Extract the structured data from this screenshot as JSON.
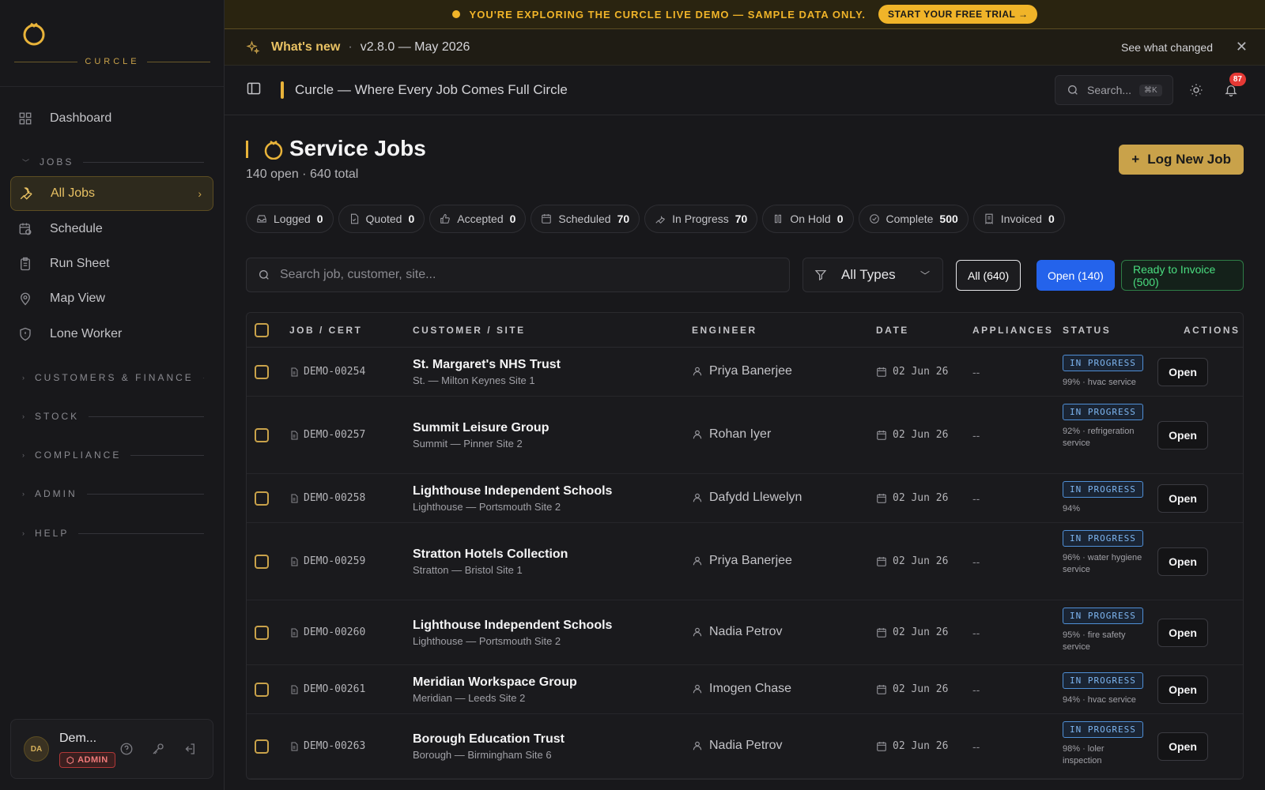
{
  "brand": {
    "name": "CURCLE"
  },
  "sidebar": {
    "dashboard": "Dashboard",
    "sections": {
      "jobs": "JOBS",
      "customers_finance": "CUSTOMERS & FINANCE",
      "stock": "STOCK",
      "compliance": "COMPLIANCE",
      "admin": "ADMIN",
      "help": "HELP"
    },
    "items": [
      {
        "label": "All Jobs",
        "icon": "wrench-icon",
        "active": true
      },
      {
        "label": "Schedule",
        "icon": "calendar-clock-icon"
      },
      {
        "label": "Run Sheet",
        "icon": "clipboard-icon"
      },
      {
        "label": "Map View",
        "icon": "map-pin-icon"
      },
      {
        "label": "Lone Worker",
        "icon": "shield-icon"
      }
    ],
    "user": {
      "initials": "DA",
      "name": "Dem...",
      "role": "ADMIN"
    }
  },
  "banner": {
    "text": "YOU'RE EXPLORING THE CURCLE LIVE DEMO — SAMPLE DATA ONLY.",
    "cta": "START YOUR FREE TRIAL →"
  },
  "whats_new": {
    "title": "What's new",
    "separator": "·",
    "version": "v2.8.0 — May 2026",
    "link": "See what changed",
    "close": "✕"
  },
  "topbar": {
    "title": "Curcle — Where Every Job Comes Full Circle",
    "search_placeholder": "Search...",
    "shortcut": "⌘K",
    "notifications": "87"
  },
  "page": {
    "title": "Service Jobs",
    "subtitle": "140 open · 640 total",
    "new_button": "Log New Job"
  },
  "status_chips": [
    {
      "label": "Logged",
      "count": "0",
      "icon": "inbox-icon"
    },
    {
      "label": "Quoted",
      "count": "0",
      "icon": "file-check-icon"
    },
    {
      "label": "Accepted",
      "count": "0",
      "icon": "thumbs-up-icon"
    },
    {
      "label": "Scheduled",
      "count": "70",
      "icon": "calendar-icon"
    },
    {
      "label": "In Progress",
      "count": "70",
      "icon": "wrench-icon"
    },
    {
      "label": "On Hold",
      "count": "0",
      "icon": "pause-icon"
    },
    {
      "label": "Complete",
      "count": "500",
      "icon": "check-circle-icon"
    },
    {
      "label": "Invoiced",
      "count": "0",
      "icon": "receipt-icon"
    }
  ],
  "filters": {
    "search_placeholder": "Search job, customer, site...",
    "type": "All Types",
    "all": "All (640)",
    "open": "Open (140)",
    "ready": "Ready to Invoice (500)"
  },
  "table": {
    "headers": {
      "job": "JOB / CERT",
      "customer": "CUSTOMER / SITE",
      "engineer": "ENGINEER",
      "date": "DATE",
      "appliances": "APPLIANCES",
      "status": "STATUS",
      "actions": "ACTIONS"
    },
    "rows": [
      {
        "job": "DEMO-00254",
        "customer": "St. Margaret's NHS Trust",
        "site": "St. — Milton Keynes Site 1",
        "engineer": "Priya Banerjee",
        "date": "02 Jun 26",
        "appliances": "--",
        "status": "IN PROGRESS",
        "detail": "99% · hvac service",
        "action": "Open"
      },
      {
        "job": "DEMO-00257",
        "customer": "Summit Leisure Group",
        "site": "Summit — Pinner Site 2",
        "engineer": "Rohan Iyer",
        "date": "02 Jun 26",
        "appliances": "--",
        "status": "IN PROGRESS",
        "detail": "92% · refrigeration service",
        "action": "Open"
      },
      {
        "job": "DEMO-00258",
        "customer": "Lighthouse Independent Schools",
        "site": "Lighthouse — Portsmouth Site 2",
        "engineer": "Dafydd Llewelyn",
        "date": "02 Jun 26",
        "appliances": "--",
        "status": "IN PROGRESS",
        "detail": "94%",
        "action": "Open"
      },
      {
        "job": "DEMO-00259",
        "customer": "Stratton Hotels Collection",
        "site": "Stratton — Bristol Site 1",
        "engineer": "Priya Banerjee",
        "date": "02 Jun 26",
        "appliances": "--",
        "status": "IN PROGRESS",
        "detail": "96% · water hygiene service",
        "action": "Open"
      },
      {
        "job": "DEMO-00260",
        "customer": "Lighthouse Independent Schools",
        "site": "Lighthouse — Portsmouth Site 2",
        "engineer": "Nadia Petrov",
        "date": "02 Jun 26",
        "appliances": "--",
        "status": "IN PROGRESS",
        "detail": "95% · fire safety service",
        "action": "Open"
      },
      {
        "job": "DEMO-00261",
        "customer": "Meridian Workspace Group",
        "site": "Meridian — Leeds Site 2",
        "engineer": "Imogen Chase",
        "date": "02 Jun 26",
        "appliances": "--",
        "status": "IN PROGRESS",
        "detail": "94% · hvac service",
        "action": "Open"
      },
      {
        "job": "DEMO-00263",
        "customer": "Borough Education Trust",
        "site": "Borough — Birmingham Site 6",
        "engineer": "Nadia Petrov",
        "date": "02 Jun 26",
        "appliances": "--",
        "status": "IN PROGRESS",
        "detail": "98% · loler inspection",
        "action": "Open"
      }
    ]
  },
  "colors": {
    "accent": "#c9a24a",
    "primary_blue": "#2463eb",
    "success": "#4ade80",
    "badge_red": "#e53935"
  }
}
